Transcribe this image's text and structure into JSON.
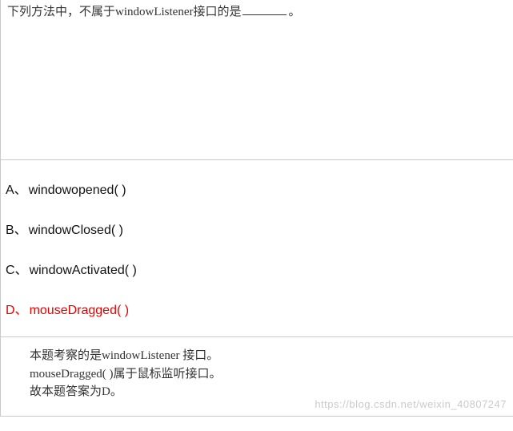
{
  "question": {
    "pre": "下列方法中，不属于windowListener接口的是",
    "post": "。"
  },
  "options": [
    {
      "letter": "A、",
      "text": "windowopened( )",
      "correct": false
    },
    {
      "letter": "B、",
      "text": "windowClosed( )",
      "correct": false
    },
    {
      "letter": "C、",
      "text": "windowActivated( )",
      "correct": false
    },
    {
      "letter": "D、",
      "text": "mouseDragged( )",
      "correct": true
    }
  ],
  "explanation": {
    "line1": "本题考察的是windowListener 接口。",
    "line2": "mouseDragged( )属于鼠标监听接口。",
    "line3": "故本题答案为D。"
  },
  "watermark": "https://blog.csdn.net/weixin_40807247"
}
